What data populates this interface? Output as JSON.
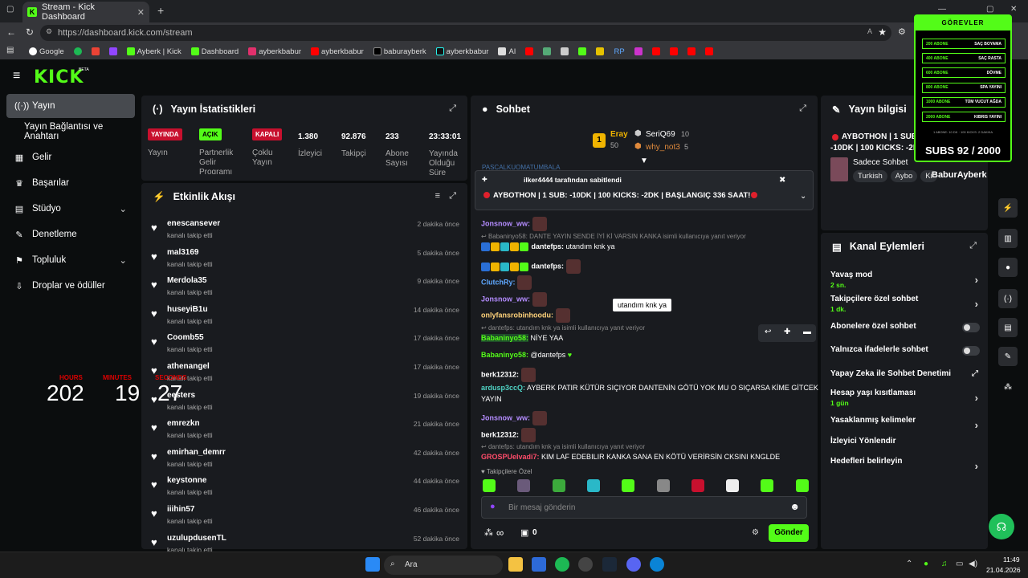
{
  "browser": {
    "tab_title": "Stream - Kick Dashboard",
    "url": "https://dashboard.kick.com/stream",
    "bookmarks": [
      "Google",
      "Ayberk | Kick",
      "Dashboard",
      "ayberkbabur",
      "ayberkbabur",
      "baburayberk",
      "ayberkbabur",
      "AI",
      "RP"
    ]
  },
  "brand": {
    "logo": "KICK",
    "beta": "BETA"
  },
  "sidebar": {
    "items": [
      "Yayın",
      "Yayın Bağlantısı ve Anahtarı",
      "Gelir",
      "Başarılar",
      "Stüdyo",
      "Denetleme",
      "Topluluk",
      "Droplar ve ödüller"
    ]
  },
  "stats": {
    "title": "Yayın İstatistikleri",
    "cols": [
      {
        "badge": "YAYINDA",
        "label": "Yayın"
      },
      {
        "badge": "AÇIK",
        "label": "Partnerlik Gelir Programı"
      },
      {
        "badge": "KAPALI",
        "label": "Çoklu Yayın"
      },
      {
        "value": "1.380",
        "label": "İzleyici"
      },
      {
        "value": "92.876",
        "label": "Takipçi"
      },
      {
        "value": "233",
        "label": "Abone Sayısı"
      },
      {
        "value": "23:33:01",
        "label": "Yayında Olduğu Süre"
      }
    ]
  },
  "activity": {
    "title": "Etkinlik Akışı",
    "action": "kanalı takip etti",
    "items": [
      {
        "name": "enescansever",
        "time": "2 dakika önce"
      },
      {
        "name": "mal3169",
        "time": "5 dakika önce"
      },
      {
        "name": "Merdola35",
        "time": "9 dakika önce"
      },
      {
        "name": "huseyiB1u",
        "time": "14 dakika önce"
      },
      {
        "name": "Coomb55",
        "time": "17 dakika önce"
      },
      {
        "name": "athenangel",
        "time": "17 dakika önce"
      },
      {
        "name": "eesters",
        "time": "19 dakika önce"
      },
      {
        "name": "emrezkn",
        "time": "21 dakika önce"
      },
      {
        "name": "emirhan_demrr",
        "time": "42 dakika önce"
      },
      {
        "name": "keystonne",
        "time": "44 dakika önce"
      },
      {
        "name": "iiihin57",
        "time": "46 dakika önce"
      },
      {
        "name": "uzulupdusenTL",
        "time": "52 dakika önce"
      }
    ]
  },
  "timer": {
    "hours_label": "HOURS",
    "minutes_label": "MINUTES",
    "seconds_label": "SECONDS",
    "hours": "202",
    "minutes": "19",
    "seconds": "27"
  },
  "chat": {
    "title": "Sohbet",
    "top": [
      {
        "name": "Eray",
        "count": "50"
      },
      {
        "name": "SeriQ69",
        "count": "10"
      },
      {
        "name": "why_not3",
        "count": "5"
      }
    ],
    "cut_name": "PASCALKUOMATUMBALA",
    "pinned_by": "ilker4444 tarafından sabitlendi",
    "pinned_msg": "AYBOTHON | 1 SUB: -10DK | 100 KICKS: -2DK | BAŞLANGIÇ 336 SAAT!",
    "messages": [
      {
        "user": "Jonsnow_ww:",
        "text": "",
        "color": "#b48cff"
      },
      {
        "reply": "Babaninyo58: DANTE YAYIN SENDE İYİ Kİ VARSIN KANKA isimli kullanıcıya yanıt veriyor"
      },
      {
        "user": "dantefps:",
        "text": "utandım knk ya",
        "color": "#ffffff"
      },
      {
        "user": "dantefps:",
        "text": "",
        "color": "#ffffff"
      },
      {
        "user": "ClutchRy:",
        "text": "",
        "color": "#5fa8ff"
      },
      {
        "user": "Jonsnow_ww:",
        "text": "",
        "color": "#b48cff"
      },
      {
        "user": "onlyfansrobinhoodu:",
        "text": "",
        "color": "#ffd27a"
      },
      {
        "reply": "dantefps: utandım knk ya isimli kullanıcıya yanıt veriyor"
      },
      {
        "user": "Babaninyo58:",
        "text": "NİYE YAA",
        "color": "#53fc18"
      },
      {
        "user": "Babaninyo58:",
        "text": "@dantefps",
        "color": "#53fc18"
      },
      {
        "user": "berk12312:",
        "text": "",
        "color": "#ffffff"
      },
      {
        "user": "ardusp3ccQ:",
        "text": "AYBERK PATIR KÜTÜR SIÇIYOR DANTENİN GÖTÜ YOK MU O SIÇARSA KİME GİTCEK",
        "color": "#4fd3c4"
      },
      {
        "text2": "YAYIN"
      },
      {
        "user": "Jonsnow_ww:",
        "text": "",
        "color": "#b48cff"
      },
      {
        "user": "berk12312:",
        "text": "",
        "color": "#ffffff"
      },
      {
        "reply": "dantefps: utandım knk ya isimli kullanıcıya yanıt veriyor"
      },
      {
        "user": "GROSPUelvadi7:",
        "text": "KIM LAF EDEBILIR KANKA SANA EN KÖTÜ VERİRSİN CKSINI KNGLDE",
        "color": "#ff4c6a"
      }
    ],
    "tooltip": "utandım knk ya",
    "followers_only": "Takipçilere Özel",
    "placeholder": "Bir mesaj gönderin",
    "infinity": "∞",
    "zero": "0",
    "send": "Gönder"
  },
  "info": {
    "title": "Yayın bilgisi",
    "stream_title": "AYBOTHON | 1 SUB: -10DK | 100 KICKS: -2DK | BAŞLANGIÇ 336 SAAT!",
    "category": "Sadece Sohbet",
    "tags": [
      "Turkish",
      "Aybo",
      "Ki"
    ],
    "watermark": "BaburAyberk"
  },
  "actions": {
    "title": "Kanal Eylemleri",
    "items": [
      {
        "label": "Yavaş mod",
        "sub": "2 sn.",
        "kind": "arrow"
      },
      {
        "label": "Takipçilere özel sohbet",
        "sub": "1 dk.",
        "kind": "arrow"
      },
      {
        "label": "Abonelere özel sohbet",
        "kind": "toggle"
      },
      {
        "label": "Yalnızca ifadelerle sohbet",
        "kind": "toggle"
      },
      {
        "label": "Yapay Zeka ile Sohbet Denetimi",
        "kind": "ext"
      },
      {
        "label": "Hesap yaşı kısıtlaması",
        "sub": "1 gün",
        "kind": "arrow"
      },
      {
        "label": "Yasaklanmış kelimeler",
        "kind": "arrow"
      },
      {
        "label": "İzleyici Yönlendir",
        "kind": "none"
      },
      {
        "label": "Hedefleri belirleyin",
        "kind": "arrow"
      }
    ]
  },
  "goals": {
    "title": "GÖREVLER",
    "rows": [
      {
        "a": "200 ABONE",
        "b": "SAÇ BOYAMA"
      },
      {
        "a": "400 ABONE",
        "b": "SAÇ RASTA"
      },
      {
        "a": "600 ABONE",
        "b": "DÖVME"
      },
      {
        "a": "800 ABONE",
        "b": "SPA YAYINI"
      },
      {
        "a": "1000 ABONE",
        "b": "TÜM VUCUT AĞDA"
      },
      {
        "a": "2000 ABONE",
        "b": "KIBRIS YAYINI"
      }
    ],
    "note": "1 ABONE: 10 DK · 100 KICKS: 2 DAKIKA",
    "subs": "SUBS 92 / 2000"
  },
  "taskbar": {
    "search": "Ara",
    "time": "11:49",
    "date": "21.04.2026"
  },
  "colors": {
    "accent": "#53fc18",
    "live": "#e0202c",
    "panel": "#191b1f"
  }
}
